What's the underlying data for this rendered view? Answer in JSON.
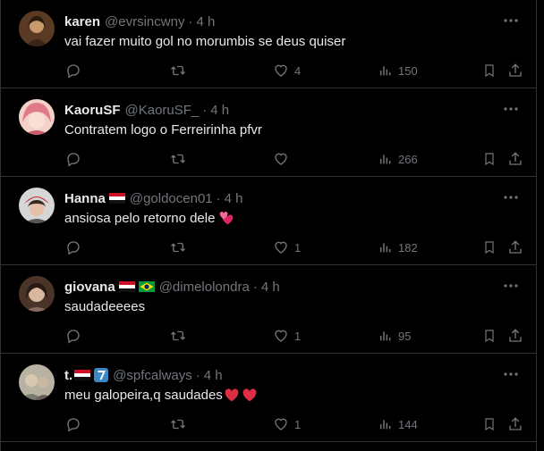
{
  "tweets": [
    {
      "name": "karen",
      "handle": "@evrsincwny",
      "dot": "·",
      "time": "4 h",
      "text": "vai fazer muito gol no morumbis se deus quiser",
      "likes": "4",
      "views": "150",
      "avatar_colors": [
        "#7a5230",
        "#c99a6b"
      ]
    },
    {
      "name": "KaoruSF",
      "handle": "@KaoruSF_",
      "dot": "·",
      "time": "4 h",
      "text": "Contratem logo o Ferreirinha pfvr",
      "likes": "",
      "views": "266",
      "avatar_colors": [
        "#e07a8a",
        "#f3d0c8"
      ]
    },
    {
      "name": "Hanna",
      "handle": "@goldocen01",
      "dot": "·",
      "time": "4 h",
      "text": "ansiosa pelo retorno dele",
      "likes": "1",
      "views": "182",
      "avatar_colors": [
        "#d6d6d6",
        "#c8302e"
      ]
    },
    {
      "name": "giovana",
      "handle": "@dimelolondra",
      "dot": "·",
      "time": "4 h",
      "text": "saudadeeees",
      "likes": "1",
      "views": "95",
      "avatar_colors": [
        "#6b4a3a",
        "#d9b8a0"
      ]
    },
    {
      "name": "t.",
      "handle": "@spfcalways",
      "dot": "·",
      "time": "4 h",
      "text": "meu galopeira,q saudades",
      "likes": "1",
      "views": "144",
      "avatar_colors": [
        "#8a8a80",
        "#c9c2b2"
      ]
    }
  ],
  "colors": {
    "background": "#000000",
    "divider": "#2f3336",
    "primary_text": "#e7e9ea",
    "secondary_text": "#71767b"
  },
  "icons": [
    "more-icon",
    "reply-icon",
    "retweet-icon",
    "like-icon",
    "views-icon",
    "bookmark-icon",
    "share-icon",
    "egypt-flag-icon",
    "brazil-flag-icon",
    "seven-keycap-icon",
    "heart-emoji-icon"
  ]
}
